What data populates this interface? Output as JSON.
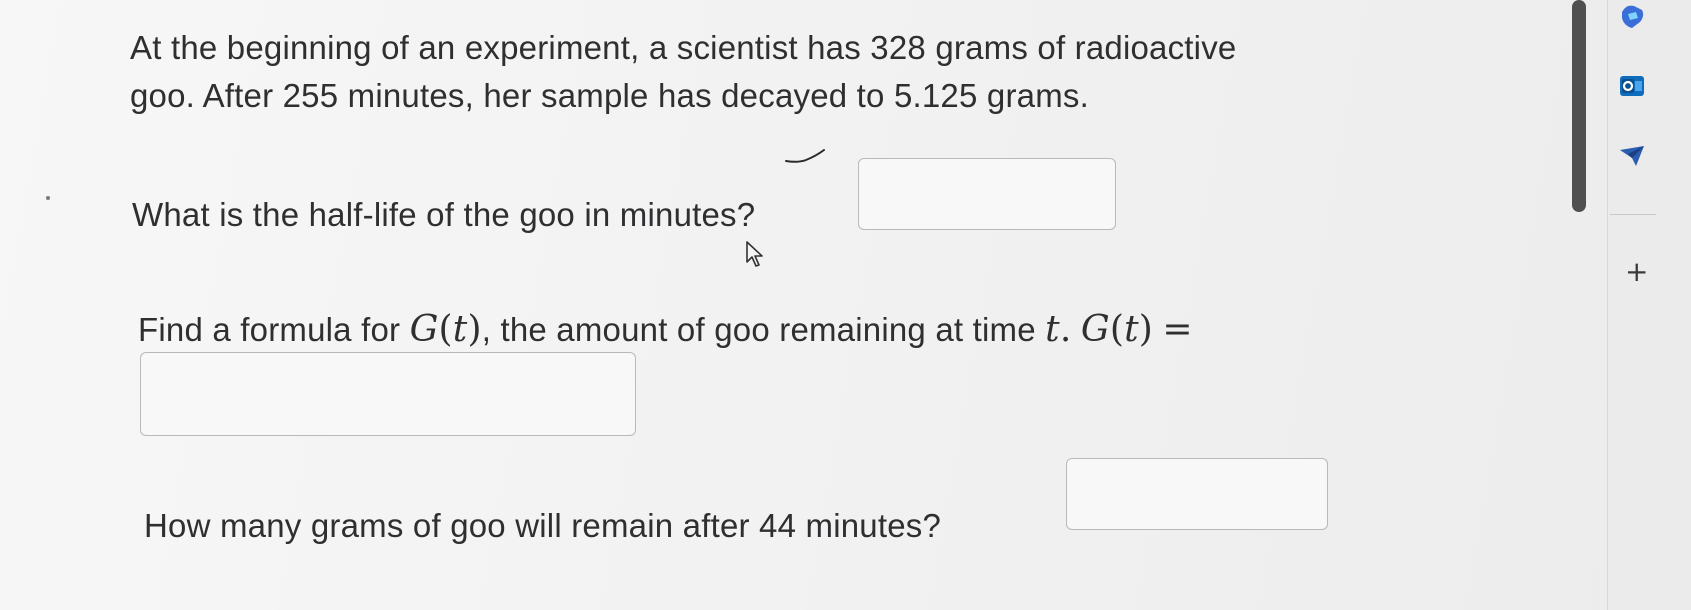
{
  "problem": {
    "intro_line1": "At the beginning of an experiment, a scientist has 328 grams of radioactive",
    "intro_line2": "goo. After 255 minutes, her sample has decayed to 5.125 grams.",
    "q1_text": "What is the half-life of the goo in minutes?",
    "q2_prefix": "Find a formula for ",
    "q2_func": "G",
    "q2_paren_open": "(",
    "q2_var": "t",
    "q2_paren_close": ")",
    "q2_middle": ", the amount of goo remaining at time ",
    "q2_time_var": "t",
    "q2_period": ".",
    "q2_lhs_func": "G",
    "q2_lhs_open": "(",
    "q2_lhs_var": "t",
    "q2_lhs_close": ")",
    "q2_equals": "=",
    "q3_text": "How many grams of goo will remain after 44 minutes?"
  },
  "answers": {
    "half_life": "",
    "formula": "",
    "remaining_grams": ""
  },
  "sidebar": {
    "icons": [
      "copilot-icon",
      "outlook-icon",
      "send-icon"
    ],
    "add_label": "+"
  },
  "colors": {
    "text": "#2f2f31",
    "box_border": "#b9b9b9",
    "outlook_blue": "#0f6cbd"
  }
}
